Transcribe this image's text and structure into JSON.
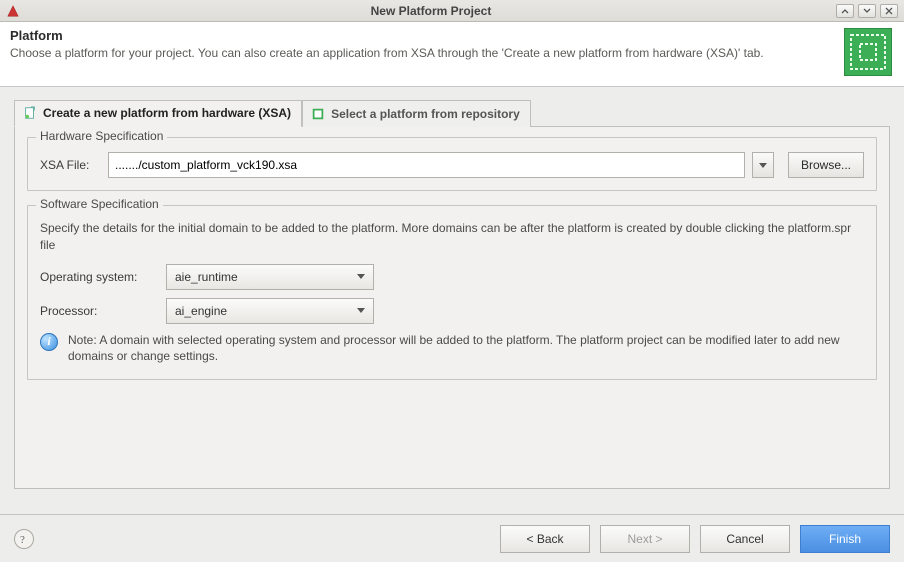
{
  "window": {
    "title": "New Platform Project"
  },
  "header": {
    "title": "Platform",
    "description": "Choose a platform for your project. You can also create an application from XSA through the 'Create a new platform from hardware (XSA)' tab."
  },
  "tabs": {
    "create": "Create a new platform from hardware (XSA)",
    "select": "Select a platform from repository"
  },
  "hardware": {
    "legend": "Hardware Specification",
    "xsa_label": "XSA File:",
    "xsa_value": "......./custom_platform_vck190.xsa",
    "browse": "Browse..."
  },
  "software": {
    "legend": "Software Specification",
    "description": "Specify the details for the initial domain to be added to the platform. More domains can be after the platform is created by double clicking the platform.spr file",
    "os_label": "Operating system:",
    "os_value": "aie_runtime",
    "proc_label": "Processor:",
    "proc_value": "ai_engine",
    "note": "Note: A domain with selected operating system and processor will be added to the platform. The platform project can be modified later to add new domains or change settings."
  },
  "footer": {
    "back": "< Back",
    "next": "Next >",
    "cancel": "Cancel",
    "finish": "Finish"
  }
}
